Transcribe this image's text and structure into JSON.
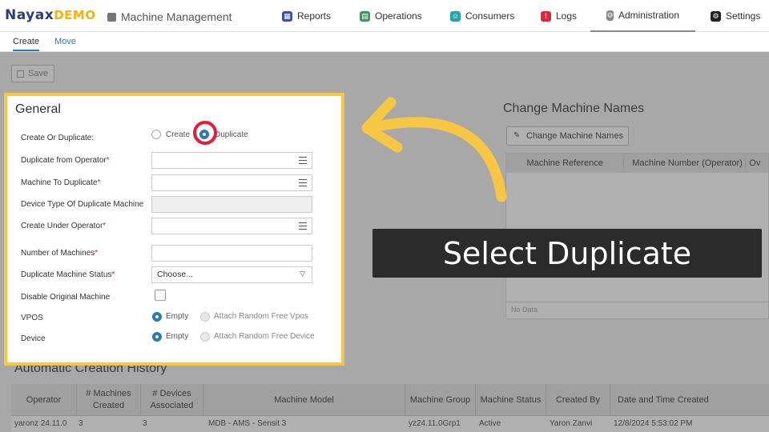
{
  "header": {
    "logo_main": "Nayax",
    "logo_sub": "DEMO",
    "app_title": "Machine Management",
    "nav": [
      {
        "label": "Reports",
        "color": "#3b4ea8",
        "glyph": "▦"
      },
      {
        "label": "Operations",
        "color": "#3a9a5b",
        "glyph": "▤"
      },
      {
        "label": "Consumers",
        "color": "#2aa3a8",
        "glyph": "☺"
      },
      {
        "label": "Logs",
        "color": "#d62c3a",
        "glyph": "!"
      },
      {
        "label": "Administration",
        "color": "#888888",
        "glyph": "⚙"
      },
      {
        "label": "Settings",
        "color": "#222222",
        "glyph": "⚙"
      }
    ]
  },
  "subtabs": {
    "create": "Create",
    "move": "Move"
  },
  "toolbar": {
    "save_label": "Save"
  },
  "general": {
    "title": "General",
    "create_or_duplicate_label": "Create Or Duplicate:",
    "opt_create": "Create",
    "opt_duplicate": "Duplicate",
    "duplicate_from_operator": "Duplicate from Operator",
    "machine_to_duplicate": "Machine To Duplicate",
    "device_type": "Device Type Of Duplicate Machine",
    "create_under_operator": "Create Under Operator",
    "number_of_machines": "Number of Machines",
    "duplicate_machine_status": "Duplicate Machine Status",
    "status_value": "Choose...",
    "disable_original": "Disable Original Machine",
    "vpos_label": "VPOS",
    "vpos_empty": "Empty",
    "vpos_random": "Attach Random Free Vpos",
    "device_label": "Device",
    "device_empty": "Empty",
    "device_random": "Attach Random Free Device",
    "required_mark": "*"
  },
  "change_names": {
    "title": "Change Machine Names",
    "button": "Change Machine Names",
    "columns": [
      "Machine Reference",
      "Machine Number (Operator)",
      "Ov"
    ],
    "no_data": "No Data"
  },
  "history": {
    "title": "Automatic Creation History",
    "columns": [
      "Operator",
      "# Machines Created",
      "# Devices Associated",
      "Machine Model",
      "Machine Group",
      "Machine Status",
      "Created By",
      "Date and Time Created"
    ],
    "row": [
      "yaronz 24.11.0",
      "3",
      "3",
      "MDB - AMS - Sensit 3",
      "yz24.11.0Grp1",
      "Active",
      "Yaron Zanvi",
      "12/8/2024 5:53:02 PM"
    ]
  },
  "callout": {
    "text": "Select Duplicate"
  },
  "colors": {
    "highlight_frame": "#f7c744",
    "ring": "#e21c39",
    "accent": "#2a7ab8"
  }
}
